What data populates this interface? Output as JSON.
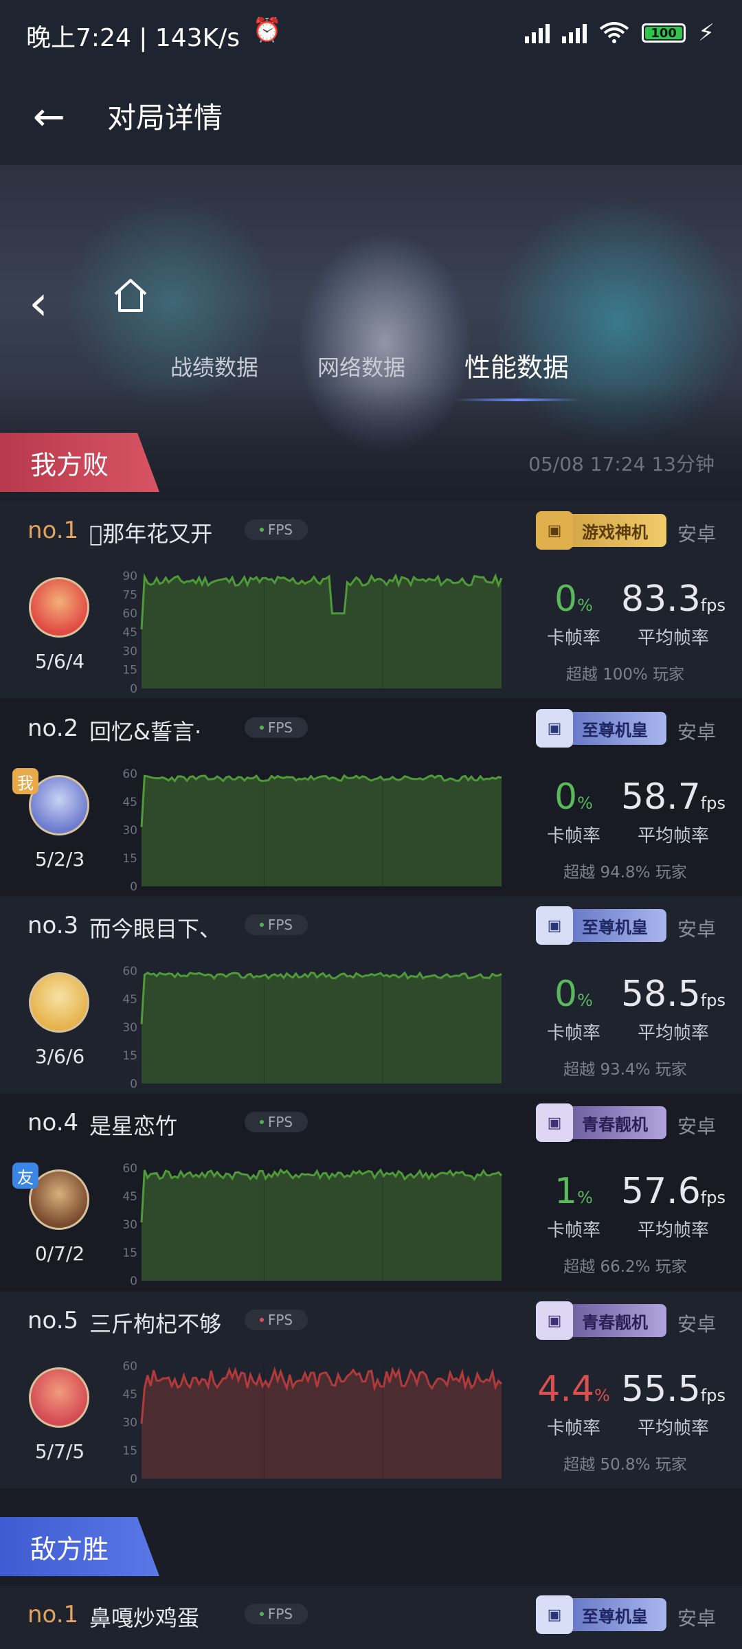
{
  "status_bar": {
    "time_speed": "晚上7:24 | 143K/s",
    "signal1": "HD",
    "signal2": "HD",
    "battery": "100"
  },
  "header": {
    "title": "对局详情"
  },
  "tabs": [
    "战绩数据",
    "网络数据",
    "性能数据"
  ],
  "our_team": {
    "label": "我方败",
    "meta": "05/08 17:24   13分钟"
  },
  "enemy_team": {
    "label": "敌方胜"
  },
  "labels": {
    "fps_pill": "FPS",
    "stutter": "卡帧率",
    "avg_fps": "平均帧率",
    "fps_unit": "fps",
    "percent_unit": "%"
  },
  "players": [
    {
      "rank": "no.1",
      "name": "\u0000那年花又开",
      "badge": "游戏神机",
      "badge_style": "gold",
      "os": "安卓",
      "kda": "5/6/4",
      "tag": "",
      "stutter": "0",
      "avg_fps": "83.3",
      "beat": "超越 100% 玩家",
      "y_ticks": [
        "90",
        "75",
        "60",
        "45",
        "30",
        "15",
        "0"
      ],
      "y_max": 90,
      "status": "good"
    },
    {
      "rank": "no.2",
      "name": "回忆&誓言·",
      "badge": "至尊机皇",
      "badge_style": "blue",
      "os": "安卓",
      "kda": "5/2/3",
      "tag": "我",
      "stutter": "0",
      "avg_fps": "58.7",
      "beat": "超越 94.8% 玩家",
      "y_ticks": [
        "60",
        "45",
        "30",
        "15",
        "0"
      ],
      "y_max": 60,
      "status": "good"
    },
    {
      "rank": "no.3",
      "name": "而今眼目下、",
      "badge": "至尊机皇",
      "badge_style": "blue",
      "os": "安卓",
      "kda": "3/6/6",
      "tag": "",
      "stutter": "0",
      "avg_fps": "58.5",
      "beat": "超越 93.4% 玩家",
      "y_ticks": [
        "60",
        "45",
        "30",
        "15",
        "0"
      ],
      "y_max": 60,
      "status": "good"
    },
    {
      "rank": "no.4",
      "name": "是星恋竹",
      "badge": "青春靓机",
      "badge_style": "purple",
      "os": "安卓",
      "kda": "0/7/2",
      "tag": "友",
      "stutter": "1",
      "avg_fps": "57.6",
      "beat": "超越 66.2% 玩家",
      "y_ticks": [
        "60",
        "45",
        "30",
        "15",
        "0"
      ],
      "y_max": 60,
      "status": "good"
    },
    {
      "rank": "no.5",
      "name": "三斤枸杞不够",
      "badge": "青春靓机",
      "badge_style": "purple",
      "os": "安卓",
      "kda": "5/7/5",
      "tag": "",
      "stutter": "4.4",
      "avg_fps": "55.5",
      "beat": "超越 50.8% 玩家",
      "y_ticks": [
        "60",
        "45",
        "30",
        "15",
        "0"
      ],
      "y_max": 60,
      "status": "bad"
    }
  ],
  "enemy_first": {
    "rank": "no.1",
    "name": "鼻嘎炒鸡蛋",
    "badge": "至尊机皇",
    "os": "安卓"
  },
  "colors": {
    "good_fill": "#2e4a2a",
    "good_line": "#4f9a38",
    "bad_fill": "#4a2c31",
    "bad_line": "#b23a3a",
    "lose_banner": "#c5424f",
    "win_banner": "#4a67da"
  }
}
